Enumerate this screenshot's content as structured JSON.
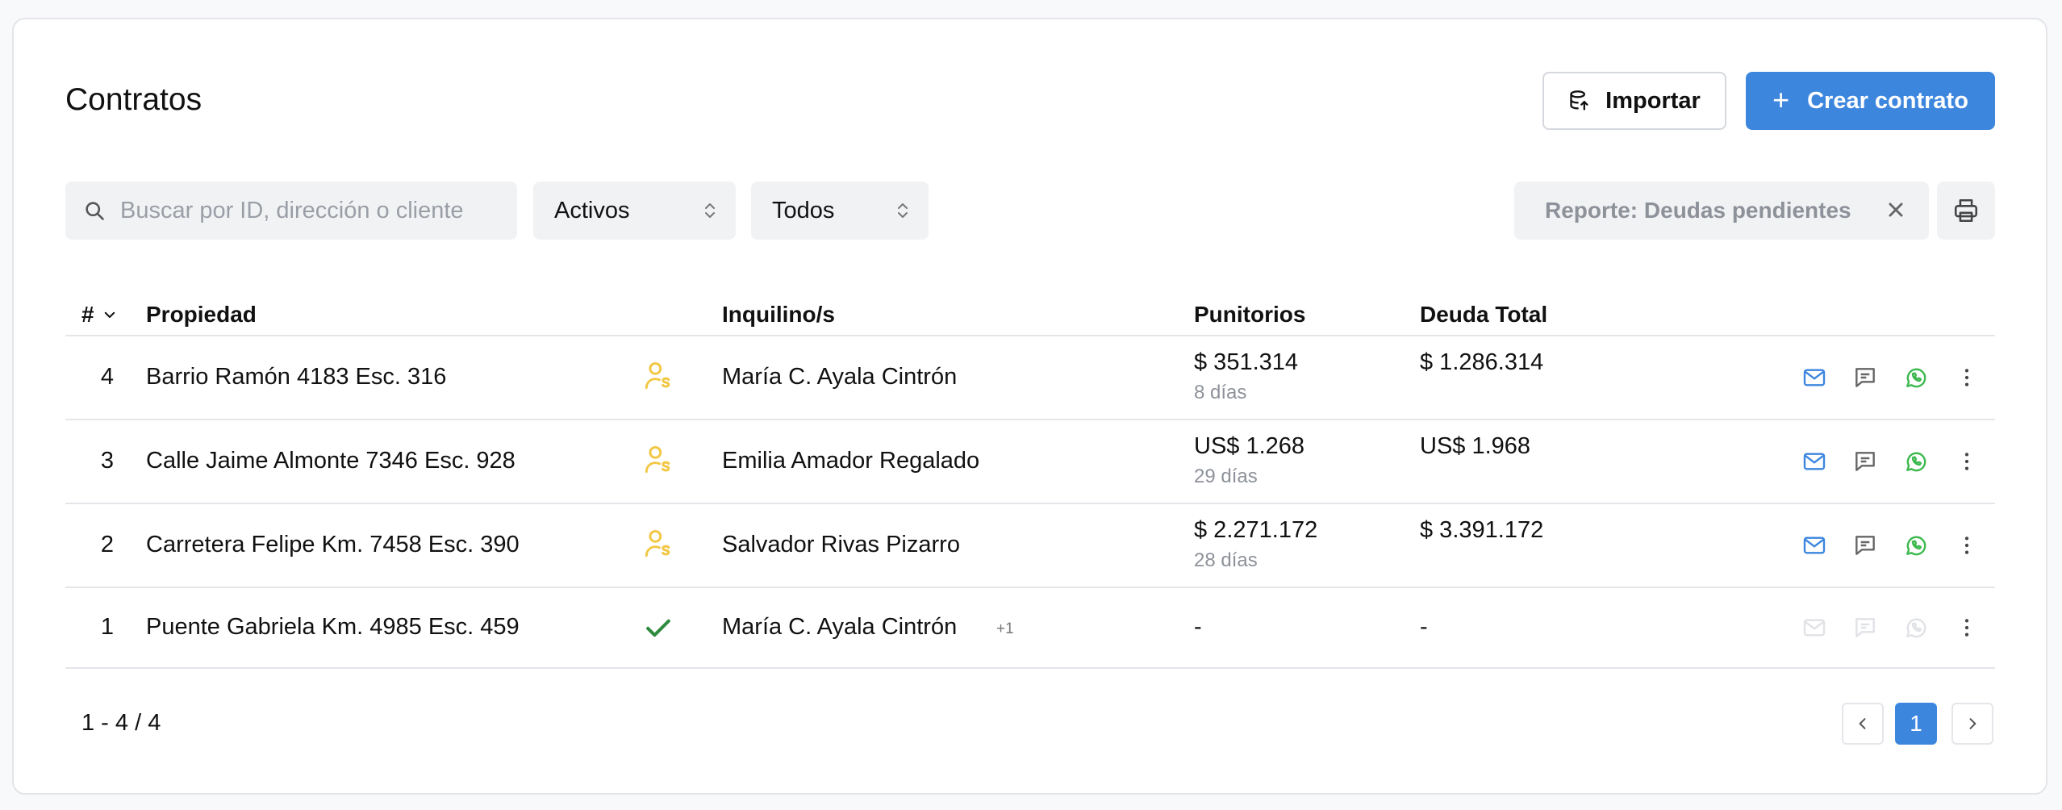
{
  "header": {
    "title": "Contratos",
    "import_label": "Importar",
    "create_label": "Crear contrato"
  },
  "filters": {
    "search_placeholder": "Buscar por ID, dirección o cliente",
    "status_value": "Activos",
    "type_value": "Todos",
    "report_chip": "Reporte: Deudas pendientes"
  },
  "table": {
    "columns": {
      "id": "#",
      "property": "Propiedad",
      "tenants": "Inquilino/s",
      "penalties": "Punitorios",
      "total_debt": "Deuda Total"
    },
    "rows": [
      {
        "id": "4",
        "property": "Barrio Ramón 4183 Esc. 316",
        "status_icon": "user-dollar-icon",
        "tenant": "María C. Ayala Cintrón",
        "extra_tenants": "",
        "penalty": "$ 351.314",
        "penalty_days": "8 días",
        "debt": "$ 1.286.314",
        "contact_enabled": true
      },
      {
        "id": "3",
        "property": "Calle Jaime Almonte 7346 Esc. 928",
        "status_icon": "user-dollar-icon",
        "tenant": "Emilia Amador Regalado",
        "extra_tenants": "",
        "penalty": "US$ 1.268",
        "penalty_days": "29 días",
        "debt": "US$ 1.968",
        "contact_enabled": true
      },
      {
        "id": "2",
        "property": "Carretera Felipe Km. 7458 Esc. 390",
        "status_icon": "user-dollar-icon",
        "tenant": "Salvador Rivas Pizarro",
        "extra_tenants": "",
        "penalty": "$ 2.271.172",
        "penalty_days": "28 días",
        "debt": "$ 3.391.172",
        "contact_enabled": true
      },
      {
        "id": "1",
        "property": "Puente Gabriela Km. 4985 Esc. 459",
        "status_icon": "check-icon",
        "tenant": "María C. Ayala Cintrón",
        "extra_tenants": "+1",
        "penalty": "-",
        "penalty_days": "",
        "debt": "-",
        "contact_enabled": false
      }
    ]
  },
  "pagination": {
    "range_label": "1 - 4 / 4",
    "current_page": "1"
  },
  "colors": {
    "accent": "#3d86de",
    "warning": "#f2c744",
    "success": "#2e8b3e",
    "whatsapp": "#3cb94f"
  }
}
